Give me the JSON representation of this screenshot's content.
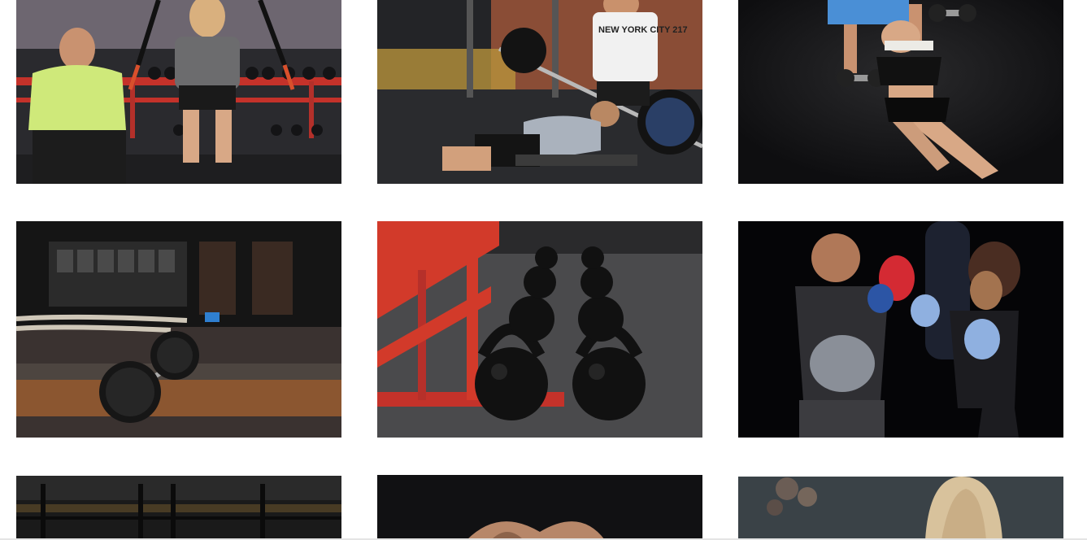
{
  "gallery": {
    "photos": [
      {
        "id": "trx-suspension-training"
      },
      {
        "id": "bench-press-spotter"
      },
      {
        "id": "dumbbell-floor-press"
      },
      {
        "id": "barbell-battle-ropes"
      },
      {
        "id": "kettlebell-rows"
      },
      {
        "id": "boxing-pad-work"
      },
      {
        "id": "dark-gym-rack"
      },
      {
        "id": "dark-athlete-portrait"
      },
      {
        "id": "blonde-athlete-portrait"
      }
    ],
    "shirt_text": "NEW YORK CITY 217"
  },
  "colors": {
    "background": "#ffffff",
    "gym_dark": "#1c1c1e",
    "rack_red": "#d23a2a",
    "lime_shirt": "#c6e86a",
    "blue_shirt": "#4a8fd6"
  }
}
